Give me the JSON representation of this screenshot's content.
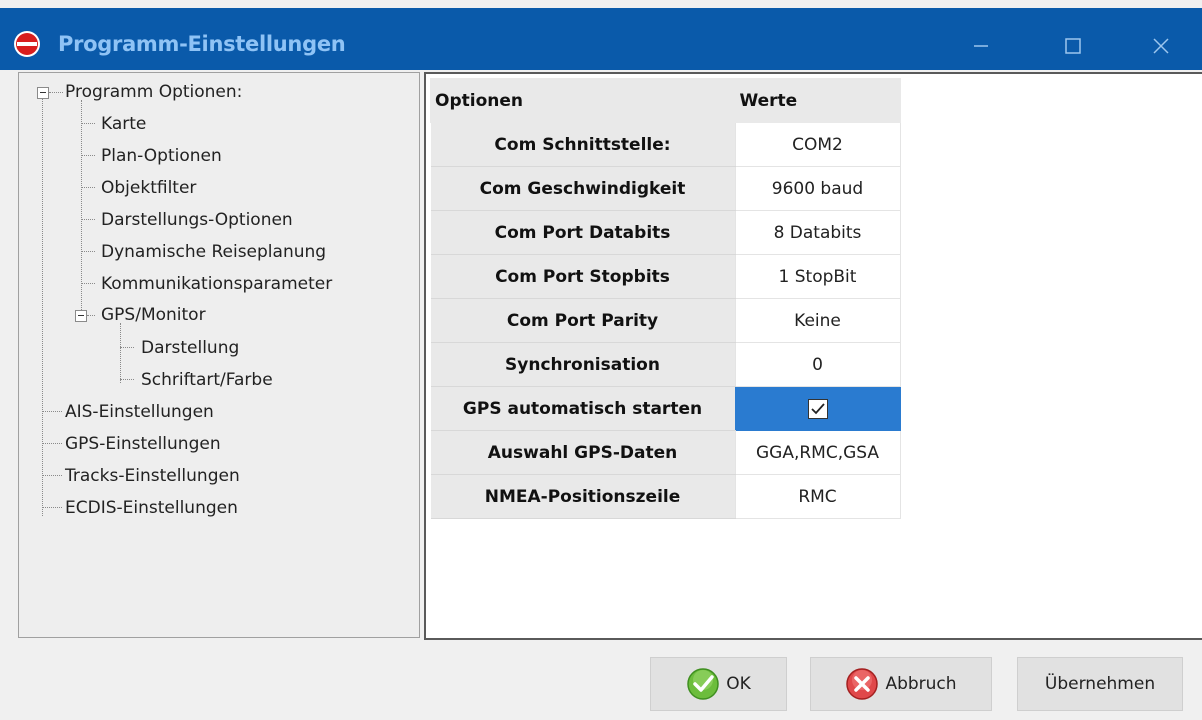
{
  "window": {
    "title": "Programm-Einstellungen"
  },
  "titlebar_buttons": {
    "minimize": "minimize-icon",
    "maximize": "maximize-icon",
    "close": "close-icon"
  },
  "tree": {
    "root": "Programm Optionen:",
    "children": [
      "Karte",
      "Plan-Optionen",
      "Objektfilter",
      "Darstellungs-Optionen",
      "Dynamische Reiseplanung",
      "Kommunikationsparameter"
    ],
    "gps_node": "GPS/Monitor",
    "gps_children": [
      "Darstellung",
      "Schriftart/Farbe"
    ],
    "siblings": [
      "AIS-Einstellungen",
      "GPS-Einstellungen",
      "Tracks-Einstellungen",
      "ECDIS-Einstellungen"
    ]
  },
  "grid": {
    "headers": {
      "option": "Optionen",
      "value": "Werte"
    },
    "rows": [
      {
        "option": "Com Schnittstelle:",
        "value": "COM2"
      },
      {
        "option": "Com Geschwindigkeit",
        "value": "9600 baud"
      },
      {
        "option": "Com Port Databits",
        "value": "8 Databits"
      },
      {
        "option": "Com Port Stopbits",
        "value": "1 StopBit"
      },
      {
        "option": "Com Port Parity",
        "value": "Keine"
      },
      {
        "option": "Synchronisation",
        "value": "0"
      },
      {
        "option": "GPS automatisch starten",
        "value": "",
        "checked": true
      },
      {
        "option": "Auswahl GPS-Daten",
        "value": "GGA,RMC,GSA"
      },
      {
        "option": "NMEA-Positionszeile",
        "value": "RMC"
      }
    ]
  },
  "buttons": {
    "ok": "OK",
    "cancel": "Abbruch",
    "apply": "Übernehmen"
  },
  "colors": {
    "titlebar": "#0a5aaa",
    "selection": "#2a7bd0"
  }
}
